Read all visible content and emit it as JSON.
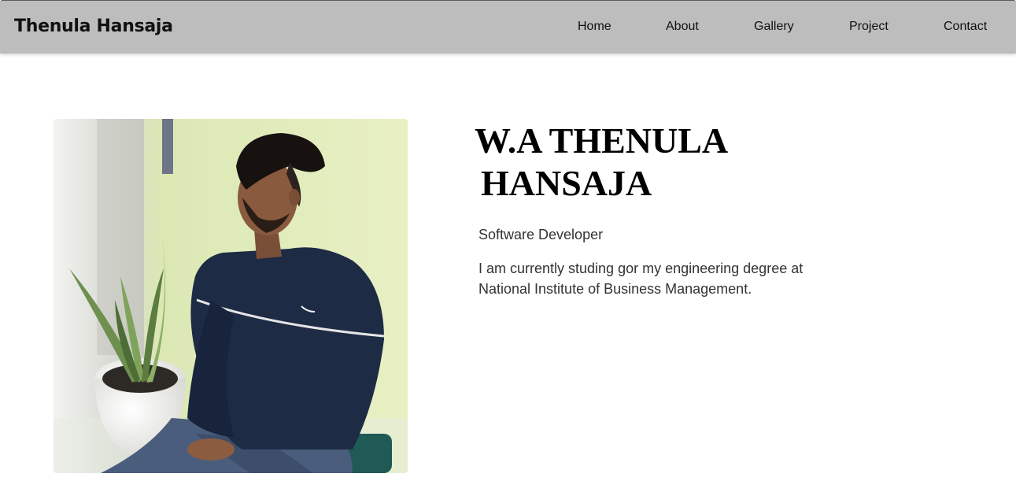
{
  "header": {
    "brand": "Thenula Hansaja",
    "nav": {
      "home": "Home",
      "about": "About",
      "gallery": "Gallery",
      "project": "Project",
      "contact": "Contact"
    }
  },
  "hero": {
    "name_line1": "W.A THENULA",
    "name_line2": "HANSAJA",
    "role": "Software Developer",
    "bio": "I am currently studing gor my engineering degree at National Institute of Business Management."
  },
  "colors": {
    "navbar_bg": "#bdbdbd",
    "text_dark": "#111111",
    "text_body": "#333333"
  }
}
